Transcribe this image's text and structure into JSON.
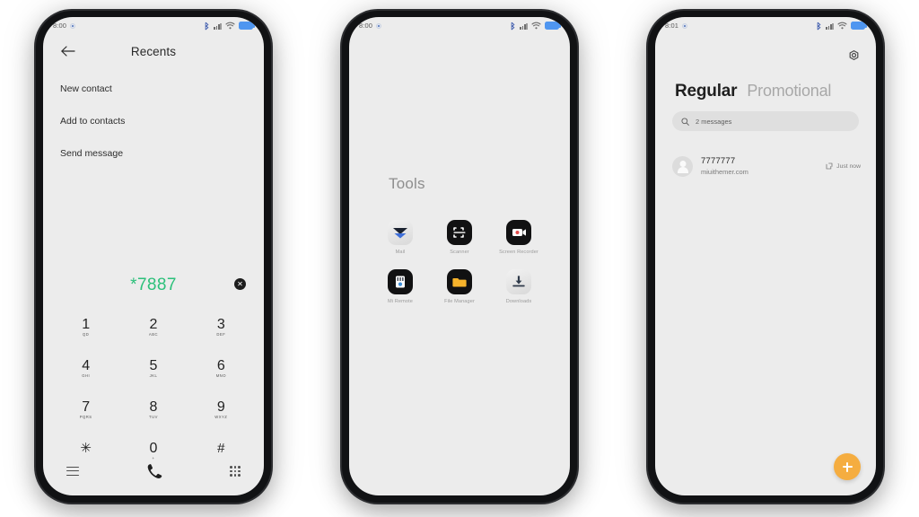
{
  "meta": {
    "background_color": "#ffffff",
    "device_bezel_color": "#111214",
    "screen_color": "#ececec"
  },
  "phones": [
    {
      "id": "phone-dialer",
      "status_bar": {
        "time": "8:00",
        "icons": [
          "notification-dot",
          "bluetooth-icon",
          "signal-icon",
          "wifi-icon",
          "battery-icon"
        ],
        "battery_color": "#4f96f0"
      },
      "app": {
        "title": "Recents",
        "back_icon": "back-arrow-icon",
        "menu_items": [
          {
            "label": "New contact"
          },
          {
            "label": "Add to contacts"
          },
          {
            "label": "Send message"
          }
        ],
        "dial_display": {
          "number": "*7887",
          "number_color": "#2bc07a",
          "clear_icon": "clear-circle-icon",
          "clear_glyph": "✕"
        },
        "keypad": [
          {
            "num": "1",
            "sub": "QD"
          },
          {
            "num": "2",
            "sub": "ABC"
          },
          {
            "num": "3",
            "sub": "DEF"
          },
          {
            "num": "4",
            "sub": "GHI"
          },
          {
            "num": "5",
            "sub": "JKL"
          },
          {
            "num": "6",
            "sub": "MNO"
          },
          {
            "num": "7",
            "sub": "PQRS"
          },
          {
            "num": "8",
            "sub": "TUV"
          },
          {
            "num": "9",
            "sub": "WXYZ"
          },
          {
            "num": "✳",
            "sub": ""
          },
          {
            "num": "0",
            "sub": "+"
          },
          {
            "num": "#",
            "sub": ""
          }
        ],
        "bottom_bar": {
          "menu_icon": "hamburger-menu-icon",
          "call_icon": "phone-call-icon",
          "keypad_icon": "keypad-grid-icon"
        }
      }
    },
    {
      "id": "phone-tools",
      "status_bar": {
        "time": "8:00",
        "icons": [
          "notification-dot",
          "bluetooth-icon",
          "signal-icon",
          "wifi-icon",
          "battery-icon"
        ],
        "battery_color": "#4f96f0"
      },
      "app": {
        "folder_title": "Tools",
        "apps": [
          {
            "label": "Mail",
            "icon": "mail-icon",
            "icon_style": "light",
            "accent": "#3f6fd8"
          },
          {
            "label": "Scanner",
            "icon": "scanner-icon",
            "icon_style": "dark",
            "accent": "#ffffff"
          },
          {
            "label": "Screen Recorder",
            "icon": "screen-recorder-icon",
            "icon_style": "dark",
            "accent": "#ffffff"
          },
          {
            "label": "Mi Remote",
            "icon": "mi-remote-icon",
            "icon_style": "dark",
            "accent": "#ffffff"
          },
          {
            "label": "File Manager",
            "icon": "file-manager-icon",
            "icon_style": "dark",
            "accent": "#f7b32b"
          },
          {
            "label": "Downloads",
            "icon": "downloads-icon",
            "icon_style": "light",
            "accent": "#2f3a4a"
          }
        ]
      }
    },
    {
      "id": "phone-messages",
      "status_bar": {
        "time": "8:01",
        "icons": [
          "notification-dot",
          "bluetooth-icon",
          "signal-icon",
          "wifi-icon",
          "battery-icon"
        ],
        "battery_color": "#4f96f0"
      },
      "app": {
        "settings_icon": "gear-icon",
        "tabs": [
          {
            "label": "Regular",
            "active": true
          },
          {
            "label": "Promotional",
            "active": false
          }
        ],
        "search": {
          "icon": "search-icon",
          "text": "2 messages"
        },
        "messages": [
          {
            "sender": "7777777",
            "preview": "miuithemer.com",
            "time": "Just now",
            "status_icon": "sent-report-icon",
            "avatar": "avatar"
          }
        ],
        "fab": {
          "icon": "plus-icon",
          "color": "#f5ad40"
        }
      }
    }
  ]
}
